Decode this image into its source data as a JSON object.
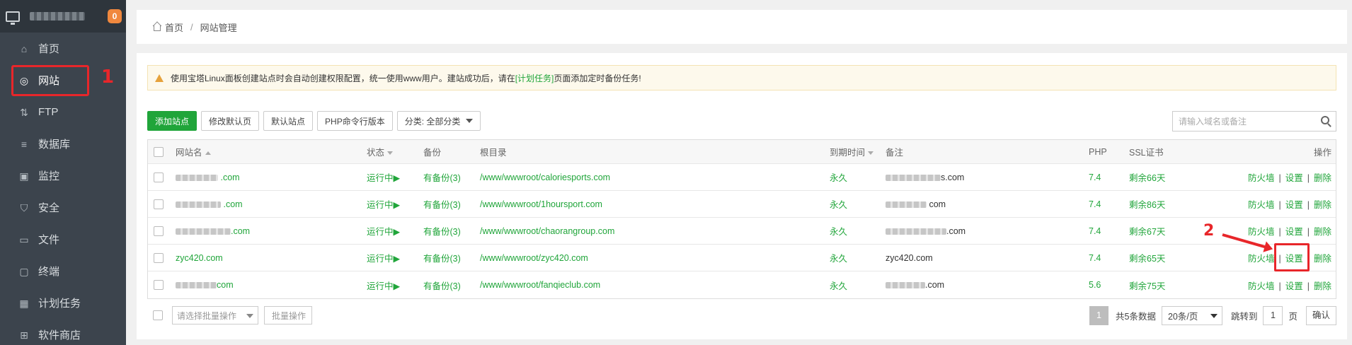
{
  "sidebar": {
    "notification_count": "0",
    "items": [
      {
        "label": "首页",
        "icon": "home-icon"
      },
      {
        "label": "网站",
        "icon": "globe-icon",
        "active": true
      },
      {
        "label": "FTP",
        "icon": "ftp-icon"
      },
      {
        "label": "数据库",
        "icon": "database-icon"
      },
      {
        "label": "监控",
        "icon": "monitor-icon"
      },
      {
        "label": "安全",
        "icon": "shield-icon"
      },
      {
        "label": "文件",
        "icon": "folder-icon"
      },
      {
        "label": "终端",
        "icon": "terminal-icon"
      },
      {
        "label": "计划任务",
        "icon": "calendar-icon"
      },
      {
        "label": "软件商店",
        "icon": "store-icon"
      }
    ]
  },
  "annotations": {
    "mark1": "1",
    "mark2": "2"
  },
  "breadcrumb": {
    "home": "首页",
    "separator": "/",
    "current": "网站管理"
  },
  "notice": {
    "text_before": "使用宝塔Linux面板创建站点时会自动创建权限配置，统一使用www用户。建站成功后，请在",
    "link": "[计划任务]",
    "text_after": "页面添加定时备份任务!"
  },
  "toolbar": {
    "add_site": "添加站点",
    "modify_default_page": "修改默认页",
    "default_site": "默认站点",
    "php_cli_version": "PHP命令行版本",
    "category": "分类: 全部分类"
  },
  "search": {
    "placeholder": "请输入域名或备注"
  },
  "table": {
    "headers": {
      "name": "网站名",
      "status": "状态",
      "backup": "备份",
      "root": "根目录",
      "expire": "到期时间",
      "note": "备注",
      "php": "PHP",
      "ssl": "SSL证书",
      "ops": "操作"
    },
    "rows": [
      {
        "name_suffix": ".com",
        "status": "运行中▶",
        "backup": "有备份(3)",
        "root": "/www/wwwroot/caloriesports.com",
        "expire": "永久",
        "note_suffix": "s.com",
        "php": "7.4",
        "ssl": "剩余66天",
        "firewall": "防火墙",
        "settings": "设置",
        "delete": "删除"
      },
      {
        "name_suffix": ".com",
        "status": "运行中▶",
        "backup": "有备份(3)",
        "root": "/www/wwwroot/1hoursport.com",
        "expire": "永久",
        "note_suffix": "com",
        "php": "7.4",
        "ssl": "剩余86天",
        "firewall": "防火墙",
        "settings": "设置",
        "delete": "删除"
      },
      {
        "name_suffix": ".com",
        "status": "运行中▶",
        "backup": "有备份(3)",
        "root": "/www/wwwroot/chaorangroup.com",
        "expire": "永久",
        "note_suffix": ".com",
        "php": "7.4",
        "ssl": "剩余67天",
        "firewall": "防火墙",
        "settings": "设置",
        "delete": "删除"
      },
      {
        "name": "zyc420.com",
        "status": "运行中▶",
        "backup": "有备份(3)",
        "root": "/www/wwwroot/zyc420.com",
        "expire": "永久",
        "note": "zyc420.com",
        "php": "7.4",
        "ssl": "剩余65天",
        "firewall": "防火墙",
        "settings": "设置",
        "delete": "删除"
      },
      {
        "name_suffix": "com",
        "status": "运行中▶",
        "backup": "有备份(3)",
        "root": "/www/wwwroot/fanqieclub.com",
        "expire": "永久",
        "note_suffix": ".com",
        "php": "5.6",
        "ssl": "剩余75天",
        "firewall": "防火墙",
        "settings": "设置",
        "delete": "删除"
      }
    ]
  },
  "footer": {
    "batch_select_placeholder": "请选择批量操作",
    "batch_button": "批量操作",
    "current_page": "1",
    "total": "共5条数据",
    "page_size": "20条/页",
    "jump_to": "跳转到",
    "jump_value": "1",
    "page_unit": "页",
    "confirm": "确认"
  }
}
